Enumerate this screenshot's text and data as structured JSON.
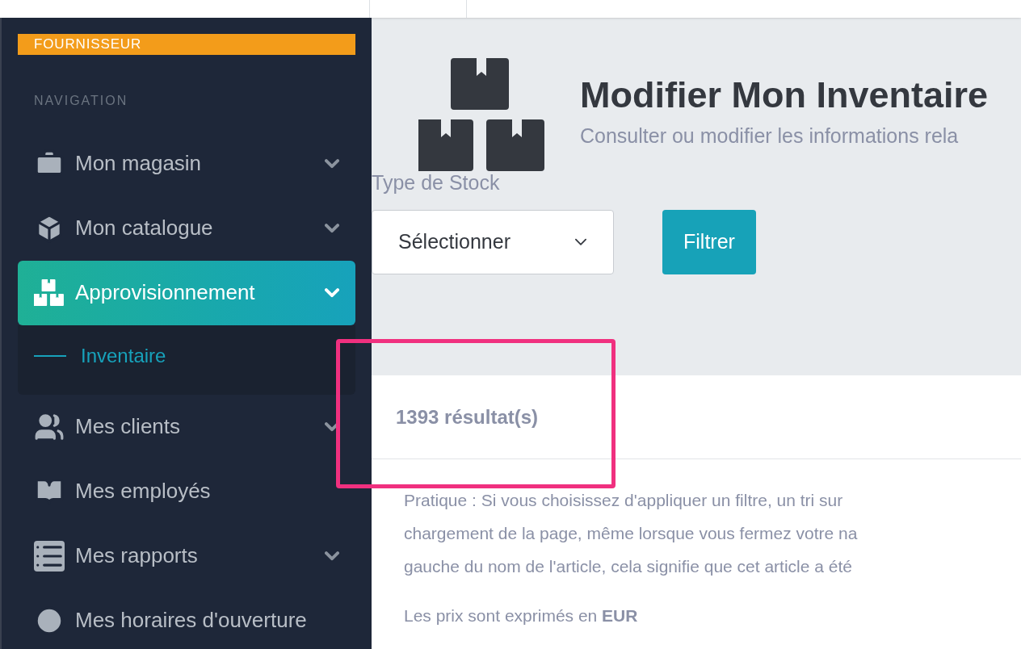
{
  "sidebar": {
    "badge": "FOURNISSEUR",
    "section": "NAVIGATION",
    "items": [
      {
        "kind": "store",
        "label": "Mon magasin",
        "has_caret": true,
        "selected": false,
        "expanded": false
      },
      {
        "kind": "catalog",
        "label": "Mon catalogue",
        "has_caret": true,
        "selected": false,
        "expanded": false
      },
      {
        "kind": "supply",
        "label": "Approvisionnement",
        "has_caret": true,
        "selected": true,
        "expanded": true,
        "children": [
          {
            "label": "Inventaire",
            "selected": true
          }
        ]
      },
      {
        "kind": "clients",
        "label": "Mes clients",
        "has_caret": true,
        "selected": false,
        "expanded": false
      },
      {
        "kind": "staff",
        "label": "Mes employés",
        "has_caret": false,
        "selected": false,
        "expanded": false
      },
      {
        "kind": "reports",
        "label": "Mes rapports",
        "has_caret": true,
        "selected": false,
        "expanded": false
      },
      {
        "kind": "hours",
        "label": "Mes horaires d'ouverture",
        "has_caret": false,
        "selected": false,
        "expanded": false
      }
    ]
  },
  "header": {
    "title": "Modifier Mon Inventaire",
    "subtitle": "Consulter ou modifier les informations rela"
  },
  "filter": {
    "label": "Type de Stock",
    "select_value": "Sélectionner",
    "button": "Filtrer"
  },
  "results": {
    "count": "1393 résultat(s)"
  },
  "notes": {
    "lines": [
      "Pratique : Si vous choisissez d'appliquer un filtre, un tri sur",
      "chargement de la page, même lorsque vous fermez votre na",
      "gauche du nom de l'article, cela signifie que cet article a été"
    ],
    "currency": "Les prix sont exprimés en **EUR**"
  }
}
